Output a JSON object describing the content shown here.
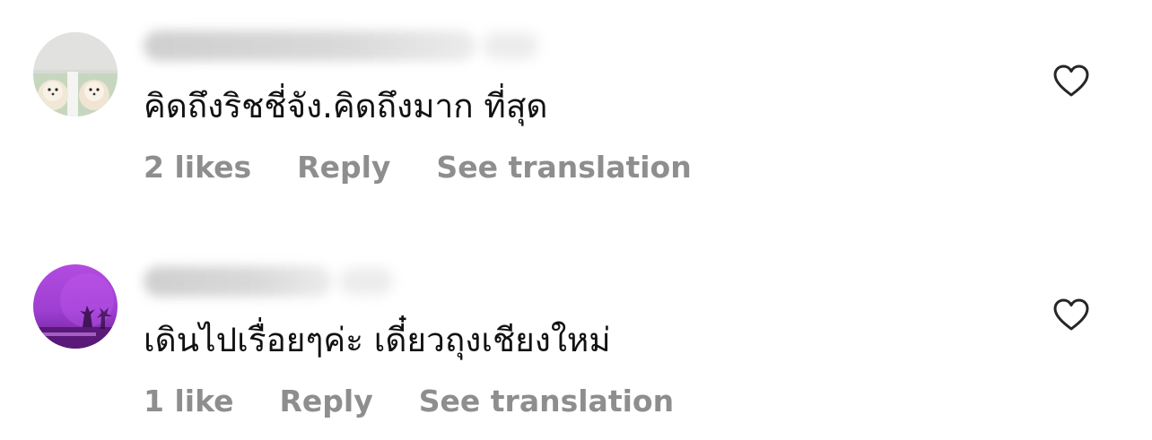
{
  "comments": [
    {
      "text": "คิดถึงริชชี่จัง.คิดถึงมาก ที่สุด",
      "likes_label": "2 likes",
      "reply_label": "Reply",
      "translate_label": "See translation",
      "like_icon": "heart-outline-icon"
    },
    {
      "text": "เดินไปเรื่อยๆค่ะ เดี๋ยวถุงเชียงใหม่",
      "likes_label": "1 like",
      "reply_label": "Reply",
      "translate_label": "See translation",
      "like_icon": "heart-outline-icon"
    }
  ],
  "colors": {
    "text": "#111111",
    "meta": "#8e8e8e",
    "icon": "#262626",
    "background": "#ffffff"
  }
}
